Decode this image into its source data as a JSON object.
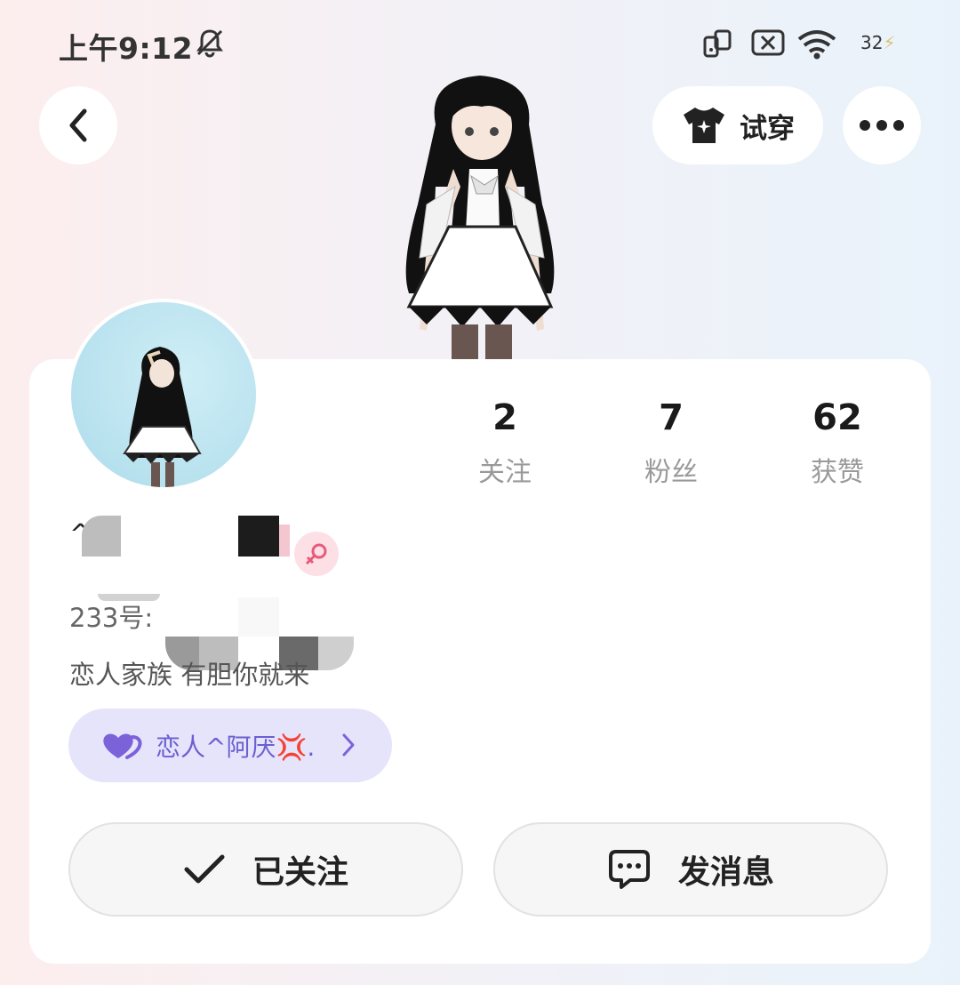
{
  "status_bar": {
    "time": "上午9:12",
    "battery": "32",
    "icons": [
      "silent-bell-icon",
      "screen-rotate-icon",
      "sim-blocked-icon",
      "wifi-icon",
      "battery-icon"
    ]
  },
  "header": {
    "back_icon": "chevron-left-icon",
    "try_on_label": "试穿",
    "try_on_icon": "tshirt-icon",
    "more_icon": "more-dots-icon"
  },
  "profile": {
    "stats": [
      {
        "value": "2",
        "label": "关注"
      },
      {
        "value": "7",
        "label": "粉丝"
      },
      {
        "value": "62",
        "label": "获赞"
      }
    ],
    "name_prefix": "^",
    "gender_icon": "female-icon",
    "id_label": "233号:",
    "bio": "恋人家族  有胆你就来",
    "lover": {
      "text": "恋人^阿厌💢.",
      "icon": "hearts-icon",
      "chevron": "chevron-right-icon"
    }
  },
  "actions": {
    "follow_label": "已关注",
    "message_label": "发消息"
  },
  "colors": {
    "lover_pill_bg": "#e6e4fb",
    "lover_text": "#6b5fd2",
    "gender_bg": "#fde0e6",
    "gender_icon": "#e85a7a"
  }
}
